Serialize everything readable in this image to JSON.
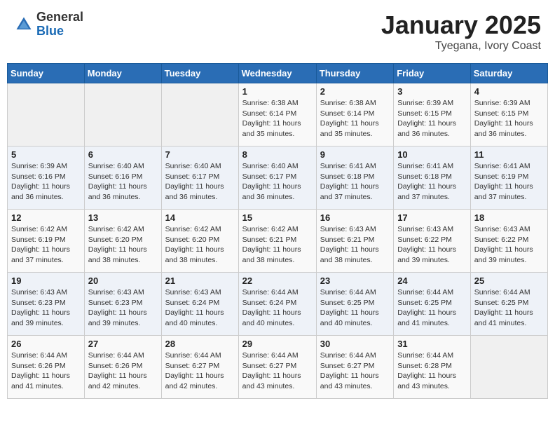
{
  "header": {
    "logo_general": "General",
    "logo_blue": "Blue",
    "month_title": "January 2025",
    "location": "Tyegana, Ivory Coast"
  },
  "days_of_week": [
    "Sunday",
    "Monday",
    "Tuesday",
    "Wednesday",
    "Thursday",
    "Friday",
    "Saturday"
  ],
  "weeks": [
    [
      {
        "day": "",
        "info": ""
      },
      {
        "day": "",
        "info": ""
      },
      {
        "day": "",
        "info": ""
      },
      {
        "day": "1",
        "info": "Sunrise: 6:38 AM\nSunset: 6:14 PM\nDaylight: 11 hours\nand 35 minutes."
      },
      {
        "day": "2",
        "info": "Sunrise: 6:38 AM\nSunset: 6:14 PM\nDaylight: 11 hours\nand 35 minutes."
      },
      {
        "day": "3",
        "info": "Sunrise: 6:39 AM\nSunset: 6:15 PM\nDaylight: 11 hours\nand 36 minutes."
      },
      {
        "day": "4",
        "info": "Sunrise: 6:39 AM\nSunset: 6:15 PM\nDaylight: 11 hours\nand 36 minutes."
      }
    ],
    [
      {
        "day": "5",
        "info": "Sunrise: 6:39 AM\nSunset: 6:16 PM\nDaylight: 11 hours\nand 36 minutes."
      },
      {
        "day": "6",
        "info": "Sunrise: 6:40 AM\nSunset: 6:16 PM\nDaylight: 11 hours\nand 36 minutes."
      },
      {
        "day": "7",
        "info": "Sunrise: 6:40 AM\nSunset: 6:17 PM\nDaylight: 11 hours\nand 36 minutes."
      },
      {
        "day": "8",
        "info": "Sunrise: 6:40 AM\nSunset: 6:17 PM\nDaylight: 11 hours\nand 36 minutes."
      },
      {
        "day": "9",
        "info": "Sunrise: 6:41 AM\nSunset: 6:18 PM\nDaylight: 11 hours\nand 37 minutes."
      },
      {
        "day": "10",
        "info": "Sunrise: 6:41 AM\nSunset: 6:18 PM\nDaylight: 11 hours\nand 37 minutes."
      },
      {
        "day": "11",
        "info": "Sunrise: 6:41 AM\nSunset: 6:19 PM\nDaylight: 11 hours\nand 37 minutes."
      }
    ],
    [
      {
        "day": "12",
        "info": "Sunrise: 6:42 AM\nSunset: 6:19 PM\nDaylight: 11 hours\nand 37 minutes."
      },
      {
        "day": "13",
        "info": "Sunrise: 6:42 AM\nSunset: 6:20 PM\nDaylight: 11 hours\nand 38 minutes."
      },
      {
        "day": "14",
        "info": "Sunrise: 6:42 AM\nSunset: 6:20 PM\nDaylight: 11 hours\nand 38 minutes."
      },
      {
        "day": "15",
        "info": "Sunrise: 6:42 AM\nSunset: 6:21 PM\nDaylight: 11 hours\nand 38 minutes."
      },
      {
        "day": "16",
        "info": "Sunrise: 6:43 AM\nSunset: 6:21 PM\nDaylight: 11 hours\nand 38 minutes."
      },
      {
        "day": "17",
        "info": "Sunrise: 6:43 AM\nSunset: 6:22 PM\nDaylight: 11 hours\nand 39 minutes."
      },
      {
        "day": "18",
        "info": "Sunrise: 6:43 AM\nSunset: 6:22 PM\nDaylight: 11 hours\nand 39 minutes."
      }
    ],
    [
      {
        "day": "19",
        "info": "Sunrise: 6:43 AM\nSunset: 6:23 PM\nDaylight: 11 hours\nand 39 minutes."
      },
      {
        "day": "20",
        "info": "Sunrise: 6:43 AM\nSunset: 6:23 PM\nDaylight: 11 hours\nand 39 minutes."
      },
      {
        "day": "21",
        "info": "Sunrise: 6:43 AM\nSunset: 6:24 PM\nDaylight: 11 hours\nand 40 minutes."
      },
      {
        "day": "22",
        "info": "Sunrise: 6:44 AM\nSunset: 6:24 PM\nDaylight: 11 hours\nand 40 minutes."
      },
      {
        "day": "23",
        "info": "Sunrise: 6:44 AM\nSunset: 6:25 PM\nDaylight: 11 hours\nand 40 minutes."
      },
      {
        "day": "24",
        "info": "Sunrise: 6:44 AM\nSunset: 6:25 PM\nDaylight: 11 hours\nand 41 minutes."
      },
      {
        "day": "25",
        "info": "Sunrise: 6:44 AM\nSunset: 6:25 PM\nDaylight: 11 hours\nand 41 minutes."
      }
    ],
    [
      {
        "day": "26",
        "info": "Sunrise: 6:44 AM\nSunset: 6:26 PM\nDaylight: 11 hours\nand 41 minutes."
      },
      {
        "day": "27",
        "info": "Sunrise: 6:44 AM\nSunset: 6:26 PM\nDaylight: 11 hours\nand 42 minutes."
      },
      {
        "day": "28",
        "info": "Sunrise: 6:44 AM\nSunset: 6:27 PM\nDaylight: 11 hours\nand 42 minutes."
      },
      {
        "day": "29",
        "info": "Sunrise: 6:44 AM\nSunset: 6:27 PM\nDaylight: 11 hours\nand 43 minutes."
      },
      {
        "day": "30",
        "info": "Sunrise: 6:44 AM\nSunset: 6:27 PM\nDaylight: 11 hours\nand 43 minutes."
      },
      {
        "day": "31",
        "info": "Sunrise: 6:44 AM\nSunset: 6:28 PM\nDaylight: 11 hours\nand 43 minutes."
      },
      {
        "day": "",
        "info": ""
      }
    ]
  ]
}
